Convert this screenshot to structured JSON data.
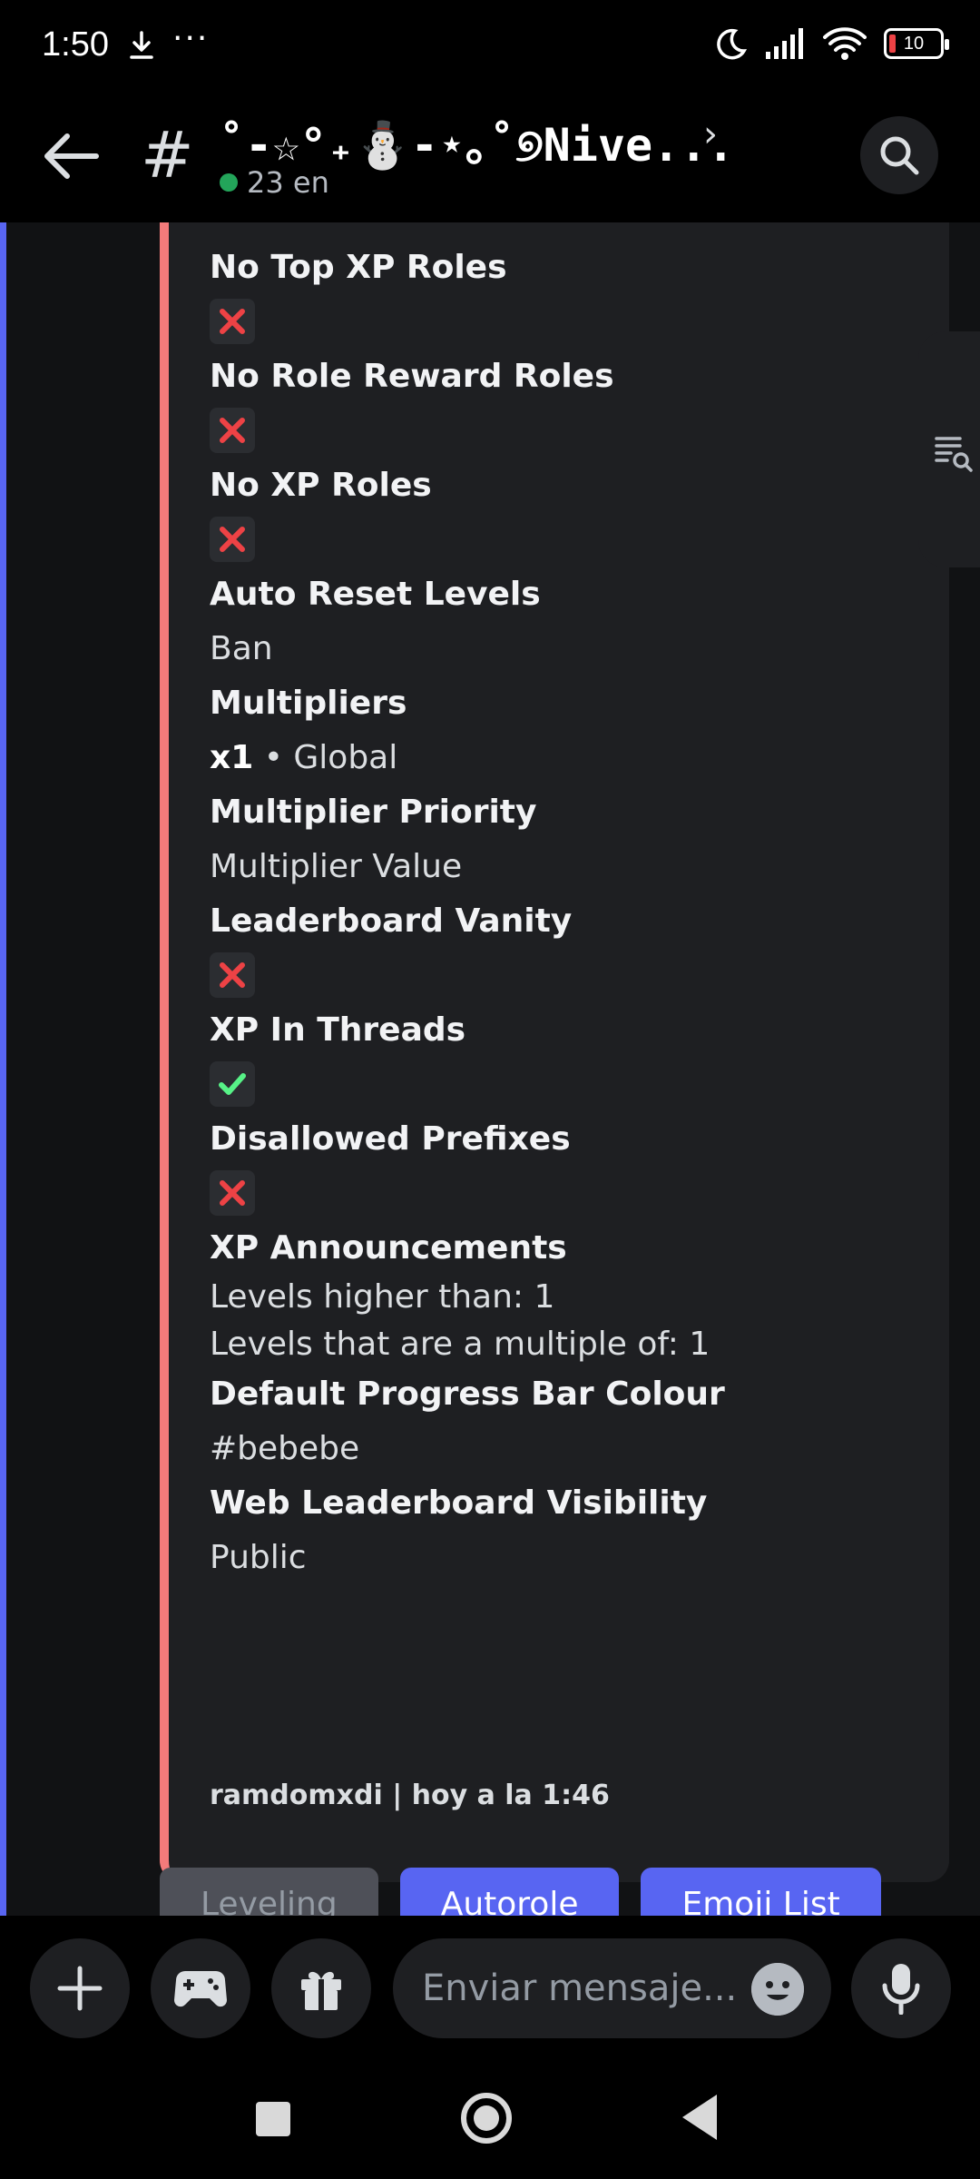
{
  "status_bar": {
    "time": "1:50",
    "more": "···",
    "battery": "10"
  },
  "header": {
    "hash": "#",
    "channel_title": "˚-☆°₊⛄-⋆｡˚୭Nive...",
    "chevron": "›",
    "online_count": "23 en"
  },
  "embed": {
    "fields": [
      {
        "name": "No Top XP Roles",
        "type": "cross"
      },
      {
        "name": "No Role Reward Roles",
        "type": "cross"
      },
      {
        "name": "No XP Roles",
        "type": "cross"
      },
      {
        "name": "Auto Reset Levels",
        "type": "text",
        "value": "Ban"
      },
      {
        "name": "Multipliers",
        "type": "mult",
        "bold": "x1",
        "value": " • Global"
      },
      {
        "name": "Multiplier Priority",
        "type": "text",
        "value": "Multiplier Value"
      },
      {
        "name": "Leaderboard Vanity",
        "type": "cross"
      },
      {
        "name": "XP In Threads",
        "type": "check"
      },
      {
        "name": "Disallowed Prefixes",
        "type": "cross"
      },
      {
        "name": "XP Announcements",
        "type": "two",
        "line1": "Levels higher than: 1",
        "line2": "Levels that are a multiple of: 1"
      },
      {
        "name": "Default Progress Bar Colour",
        "type": "text",
        "value": "#bebebe"
      },
      {
        "name": "Web Leaderboard Visibility",
        "type": "text",
        "value": "Public"
      }
    ],
    "footer": "ramdomxdi | hoy a la 1:46"
  },
  "tabs": [
    {
      "label": "Leveling",
      "active": false
    },
    {
      "label": "Autorole",
      "active": true
    },
    {
      "label": "Emoji List",
      "active": true
    }
  ],
  "composer": {
    "placeholder": "Enviar mensaje..."
  },
  "colors": {
    "embed_border": "#f47b7b",
    "cross": "#ed4245",
    "check": "#57f287",
    "accent": "#5865f2"
  }
}
